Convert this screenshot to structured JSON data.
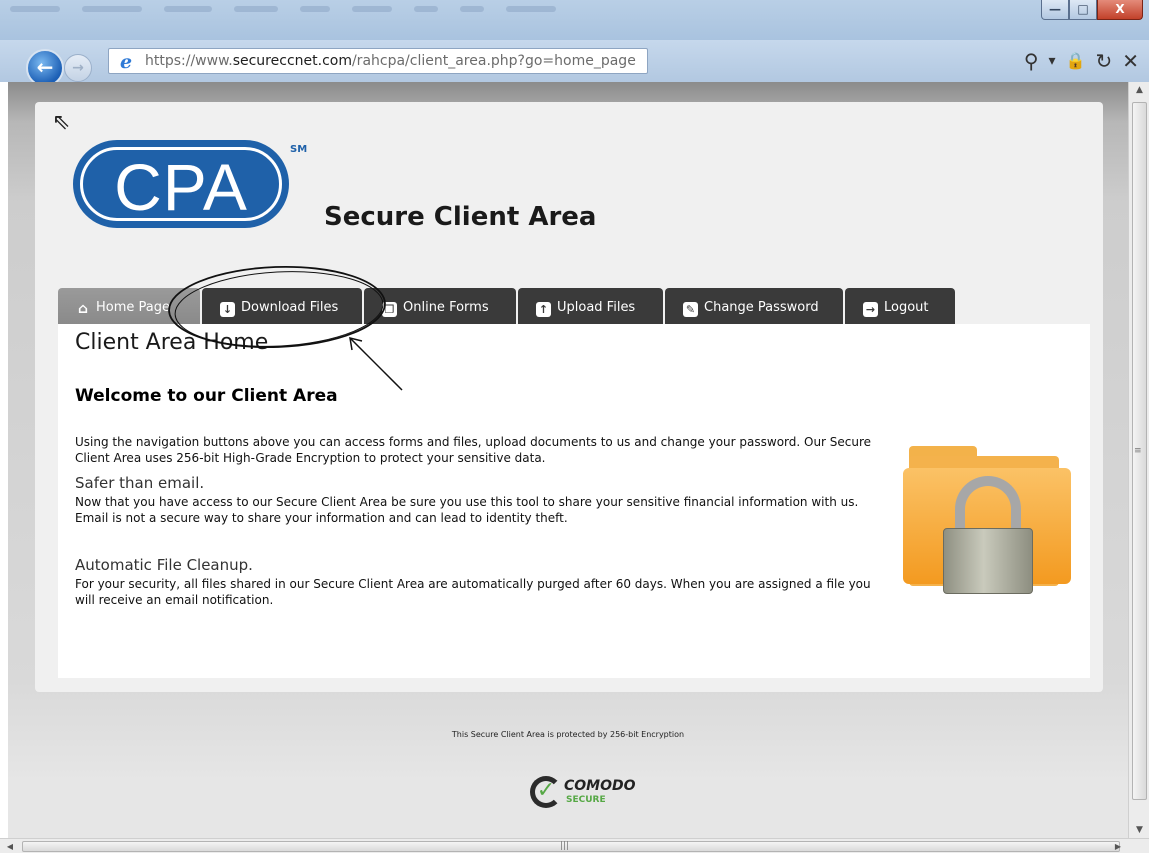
{
  "browser": {
    "url_prefix": "https://www.",
    "url_domain": "secureccnet.com",
    "url_path": "/rahcpa/client_area.php?go=home_page",
    "window_buttons": {
      "minimize": "—",
      "maximize": "□",
      "close": "X"
    },
    "tools": {
      "search": "⚲",
      "dropdown": "▾",
      "lock": "🔒",
      "refresh": "↻",
      "stop": "✕"
    },
    "back": "←",
    "forward": "→",
    "favicon": "e"
  },
  "page": {
    "logo_text": "CPA",
    "logo_mark": "SM",
    "site_title": "Secure Client Area",
    "nav": {
      "tabs": [
        {
          "label": "Home Page",
          "icon": "home-icon",
          "active": true
        },
        {
          "label": "Download Files",
          "icon": "download-icon",
          "active": false
        },
        {
          "label": "Online Forms",
          "icon": "forms-icon",
          "active": false
        },
        {
          "label": "Upload Files",
          "icon": "upload-icon",
          "active": false
        },
        {
          "label": "Change Password",
          "icon": "password-icon",
          "active": false
        },
        {
          "label": "Logout",
          "icon": "logout-icon",
          "active": false
        }
      ]
    },
    "content": {
      "title": "Client Area Home",
      "welcome": "Welcome to our Client Area",
      "intro": "Using the navigation buttons above you can access forms and files, upload documents to us and change your password. Our Secure Client Area uses 256-bit High-Grade Encryption to protect your sensitive data.",
      "section1_title": "Safer than email.",
      "section1_body": "Now that you have access to our Secure Client Area be sure you use this tool to share your sensitive financial information with us. Email is not a secure way to share your information and can lead to identity theft.",
      "section2_title": "Automatic File Cleanup.",
      "section2_body": "For your security, all files shared in our Secure Client Area are automatically purged after 60 days. When you are assigned a file you will receive an email notification."
    },
    "footer": {
      "text": "This Secure Client Area is protected by 256-bit Encryption",
      "badge_name": "COMODO",
      "badge_sub": "SECURE"
    }
  },
  "colors": {
    "brand_blue": "#1f61a9",
    "tab_dark": "#3a3a3a",
    "tab_active": "#8e8e8e",
    "folder_orange": "#f39a20"
  }
}
